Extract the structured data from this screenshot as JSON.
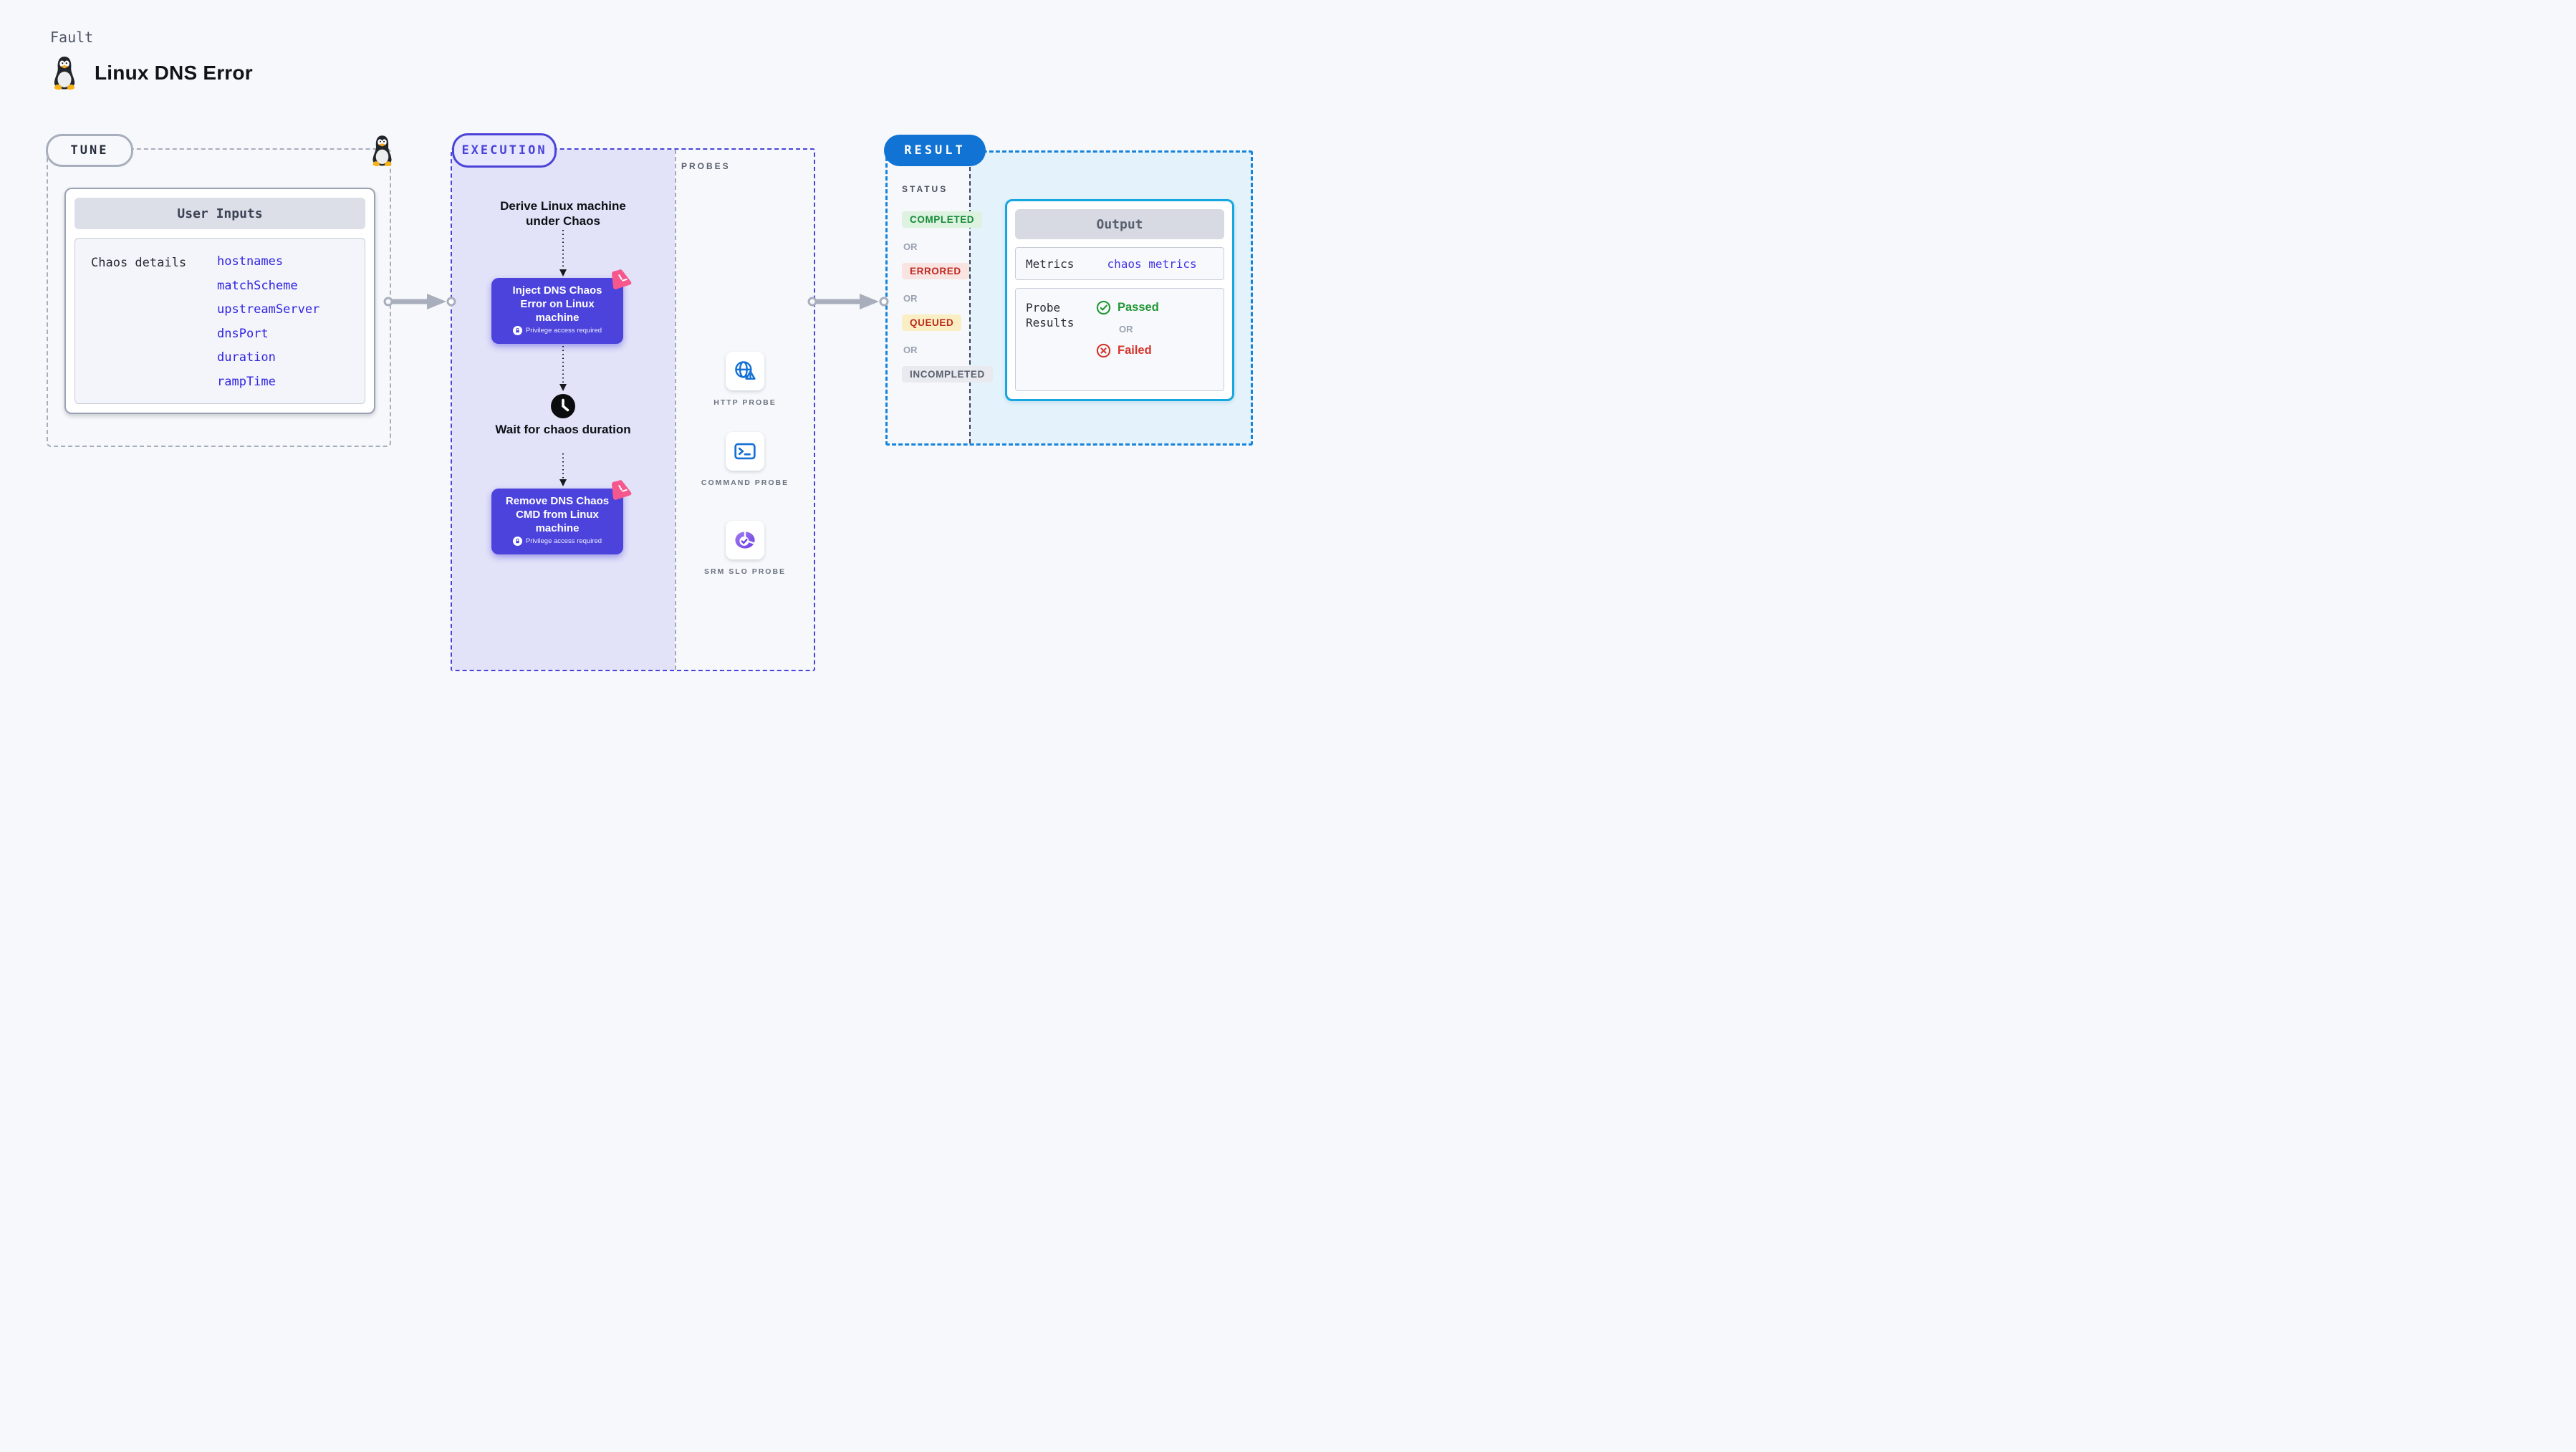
{
  "page": {
    "kicker": "Fault",
    "title": "Linux DNS Error"
  },
  "tune": {
    "label": "TUNE",
    "card_title": "User Inputs",
    "row_label": "Chaos details",
    "inputs": [
      "hostnames",
      "matchScheme",
      "upstreamServer",
      "dnsPort",
      "duration",
      "rampTime"
    ]
  },
  "execution": {
    "label": "EXECUTION",
    "steps": {
      "derive": "Derive Linux machine under Chaos",
      "inject": "Inject DNS Chaos Error on Linux machine",
      "wait": "Wait for chaos duration",
      "remove": "Remove DNS Chaos CMD from Linux machine",
      "privilege_note": "Privilege access required"
    },
    "probes": {
      "label": "PROBES",
      "items": [
        {
          "name": "HTTP PROBE",
          "icon": "globe-alert-icon"
        },
        {
          "name": "COMMAND PROBE",
          "icon": "terminal-icon"
        },
        {
          "name": "SRM SLO PROBE",
          "icon": "slo-donut-icon"
        }
      ]
    }
  },
  "result": {
    "label": "RESULT",
    "status": {
      "label": "STATUS",
      "separator": "OR",
      "badges": [
        "COMPLETED",
        "ERRORED",
        "QUEUED",
        "INCOMPLETED"
      ]
    },
    "output": {
      "title": "Output",
      "metrics_label": "Metrics",
      "metrics_link": "chaos metrics",
      "probe_results_label": "Probe Results",
      "passed": "Passed",
      "or": "OR",
      "failed": "Failed"
    }
  },
  "colors": {
    "background": "#F6F8FB",
    "indigo_accent": "#4B43D8",
    "node_button": "#4B43DB",
    "lavender_panel": "#E2E2F8",
    "result_blue": "#1173D3",
    "result_dash": "#1684DC",
    "cyan_panel": "#E4F3FB",
    "output_border": "#16A6E0",
    "link_blue": "#3023E2",
    "probe_icon_blue": "#1470D6",
    "slo_purple": "#7C4FE8",
    "pink_badge": "#F6578D",
    "passed_green": "#1F9733",
    "failed_red": "#D5352B",
    "completed_green": "#168A38",
    "errored_red": "#C1271E",
    "queued_red": "#BD2A1B",
    "gray_dash": "#A7AEBC",
    "arrow_gray": "#A9AEBD"
  }
}
